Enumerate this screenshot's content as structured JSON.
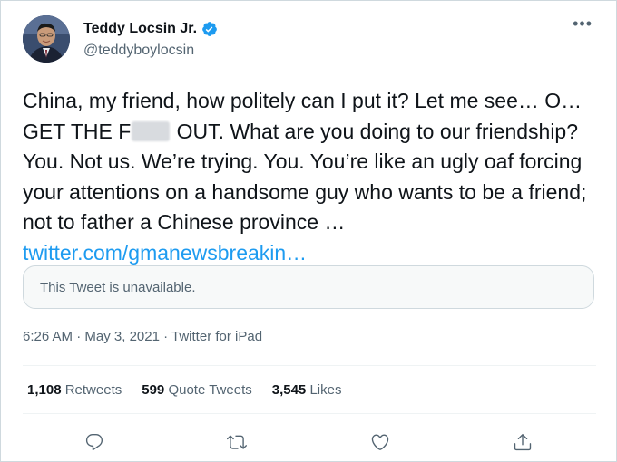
{
  "author": {
    "name": "Teddy Locsin Jr.",
    "handle": "@teddyboylocsin",
    "verified": true
  },
  "tweet": {
    "text_part1": "China, my friend, how politely can I put it? Let me see… O…GET THE F",
    "text_part2": " OUT. What are you doing to our friendship? You. Not us. We’re trying. You. You’re like an ugly oaf forcing your attentions on a handsome guy who wants to be a friend; not to father a Chinese province … ",
    "link": "twitter.com/gmanewsbreakin…"
  },
  "quote": {
    "unavailable_text": "This Tweet is unavailable."
  },
  "meta": {
    "time": "6:26 AM",
    "separator1": " · ",
    "date": "May 3, 2021",
    "separator2": " · ",
    "source": "Twitter for iPad"
  },
  "stats": {
    "retweets_count": "1,108",
    "retweets_label": "Retweets",
    "quotes_count": "599",
    "quotes_label": "Quote Tweets",
    "likes_count": "3,545",
    "likes_label": "Likes"
  },
  "colors": {
    "accent": "#1d9bf0",
    "text_primary": "#0f1419",
    "text_secondary": "#536471",
    "border": "#cfd9de"
  },
  "icons": {
    "more": "more-icon",
    "verified": "verified-badge-icon",
    "reply": "reply-icon",
    "retweet": "retweet-icon",
    "like": "like-icon",
    "share": "share-icon"
  }
}
